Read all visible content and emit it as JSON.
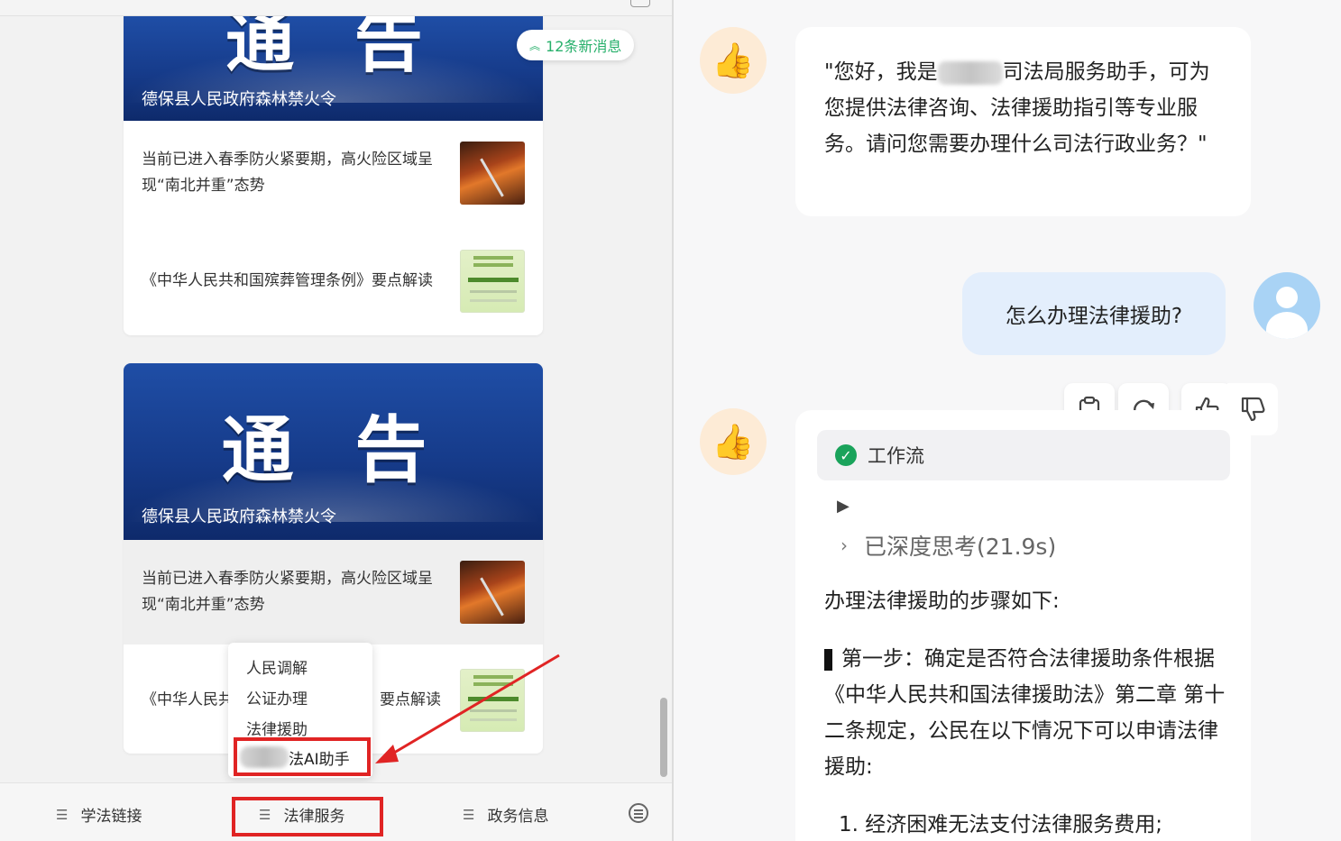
{
  "left_panel": {
    "new_messages_badge": "12条新消息",
    "cards": [
      {
        "banner_title": "通 告",
        "banner_subtitle": "德保县人民政府森林禁火令",
        "news": [
          {
            "text": "当前已进入春季防火紧要期，高火险区域呈现“南北并重”态势",
            "thumb": "forest-fire-photo"
          },
          {
            "text": "《中华人民共和国殡葬管理条例》要点解读",
            "thumb": "document-cover"
          }
        ]
      },
      {
        "banner_title": "通 告",
        "banner_subtitle": "德保县人民政府森林禁火令",
        "news": [
          {
            "text": "当前已进入春季防火紧要期，高火险区域呈现“南北并重”态势",
            "thumb": "forest-fire-photo"
          },
          {
            "text_left": "《中华人民共",
            "text_right": "要点解读",
            "thumb": "document-cover"
          }
        ]
      }
    ],
    "popup_menu": {
      "items": [
        "人民调解",
        "公证办理",
        "法律援助"
      ],
      "highlighted_item": "司法AI助手",
      "highlighted_item_visible_text": "法AI助手"
    },
    "tabbar": {
      "tabs": [
        {
          "label": "学法链接",
          "icon": "menu-icon"
        },
        {
          "label": "法律服务",
          "icon": "menu-icon",
          "highlighted": true
        },
        {
          "label": "政务信息",
          "icon": "menu-icon"
        }
      ],
      "keyboard_icon": "keyboard-icon"
    },
    "highlight_color": "#e02424"
  },
  "right_panel": {
    "bot_avatar_icon": "thumbs-up-emoji",
    "bot_greeting_before": "\"您好，我是",
    "bot_greeting_after": "司法局服务助手，可为您提供法律咨询、法律援助指引等专业服务。请问您需要办理什么司法行政业务？\"",
    "user_message": "怎么办理法律援助?",
    "action_buttons": [
      "copy-icon",
      "refresh-icon",
      "thumbs-up-icon",
      "thumbs-down-icon"
    ],
    "workflow_label": "工作流",
    "thinking_label": "已深度思考(21.9s)",
    "answer_intro": "办理法律援助的步骤如下:",
    "step_text": "第一步：确定是否符合法律援助条件根据《中华人民共和国法律援助法》第二章 第十二条规定，公民在以下情况下可以申请法律援助:",
    "list_item_1": "1. 经济困难无法支付法律服务费用;",
    "colors": {
      "user_bubble": "#e3eefc",
      "check_green": "#1aa35b",
      "banner_blue": "#163b8a"
    }
  }
}
